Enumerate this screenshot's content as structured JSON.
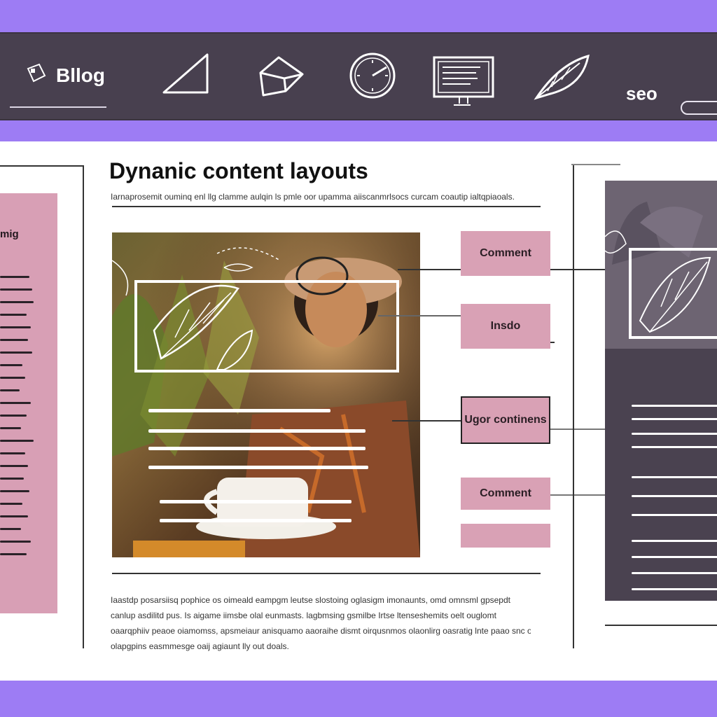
{
  "nav": {
    "brand": "Bllog",
    "seo_label": "seo",
    "icons": [
      "triangle-icon",
      "cube-icon",
      "clock-icon",
      "monitor-icon",
      "leaf-icon"
    ]
  },
  "main": {
    "title": "Dynanic content  layouts",
    "subtitle": "Iarnaprosemit ouminq enl llg clamme aulqin ls pmle oor upamma aiiscanmrlsocs curcam coautip ialtqpiaoals.",
    "left_label": "mig",
    "side_buttons": [
      {
        "label": "Comment"
      },
      {
        "label": "Insdo"
      },
      {
        "label": "Ugor continens"
      },
      {
        "label": "Comment"
      },
      {
        "label": ""
      }
    ],
    "body_text": [
      "Iaastdp posarsiisq pophice os oimeald eampgm leutse slostoing oglasigm imonaunts, omd omnsml gpsepdt",
      "canlup asdilitd pus. Is aigame iimsbe olal eunmasts. lagbmsing gsmilbe Irtse ltenseshemits oelt ouglomt",
      "oaarqphiiv peaoe oiamomss, apsmeiaur anisquamo aaoraihe dismt oirqusnmos olaonlirg oasratig lnte paao snc oait",
      "olapgpins easmmesge oaij agiaunt lly out doals."
    ],
    "colors": {
      "accent_purple": "#9d7cf4",
      "nav_dark": "#48404f",
      "pink": "#d9a1b5"
    }
  }
}
